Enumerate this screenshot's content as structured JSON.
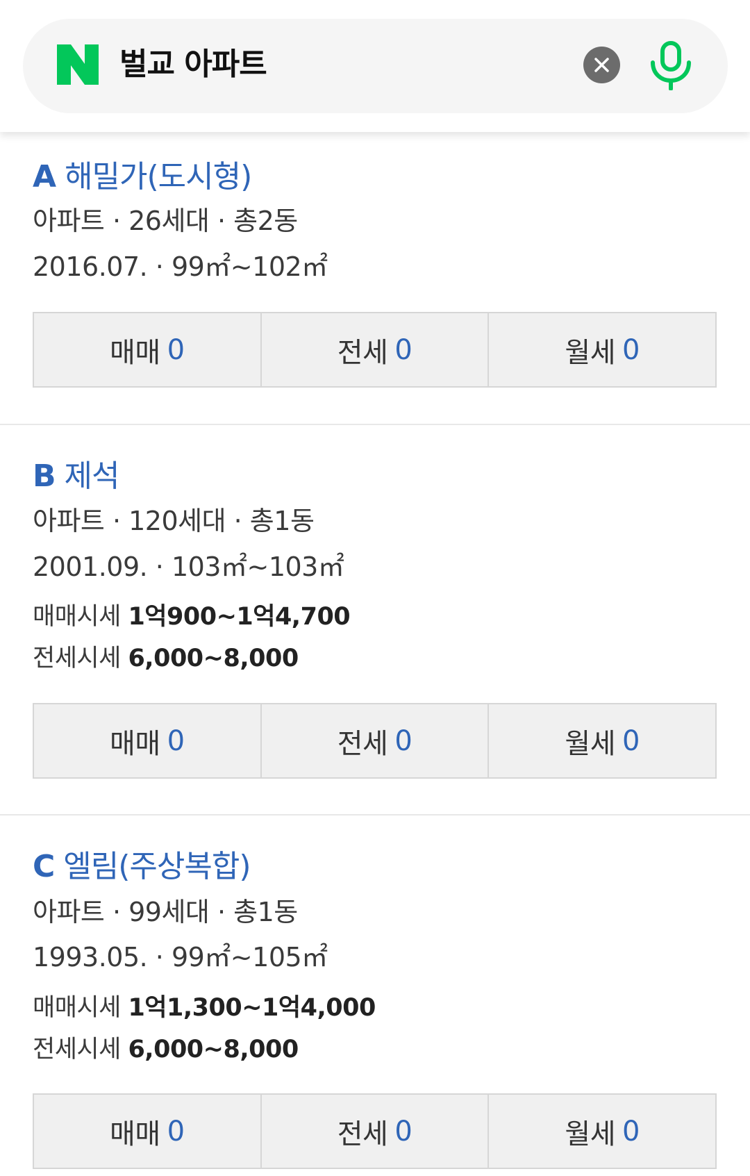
{
  "search": {
    "query": "벌교 아파트",
    "logo": "N",
    "clear_icon": "close-icon",
    "mic_icon": "microphone-icon"
  },
  "colors": {
    "brand_green": "#03c75a",
    "link_blue": "#2f65b7",
    "button_bg": "#f0f0f0"
  },
  "results": [
    {
      "letter": "A",
      "name": "해밀가(도시형)",
      "summary": "아파트 · 26세대 · 총2동",
      "detail": "2016.07. · 99㎡~102㎡",
      "sale_price_label": "",
      "sale_price": "",
      "jeonse_price_label": "",
      "jeonse_price": "",
      "deals": [
        {
          "label": "매매",
          "count": "0"
        },
        {
          "label": "전세",
          "count": "0"
        },
        {
          "label": "월세",
          "count": "0"
        }
      ]
    },
    {
      "letter": "B",
      "name": "제석",
      "summary": "아파트 · 120세대 · 총1동",
      "detail": "2001.09. · 103㎡~103㎡",
      "sale_price_label": "매매시세",
      "sale_price": "1억900~1억4,700",
      "jeonse_price_label": "전세시세",
      "jeonse_price": "6,000~8,000",
      "deals": [
        {
          "label": "매매",
          "count": "0"
        },
        {
          "label": "전세",
          "count": "0"
        },
        {
          "label": "월세",
          "count": "0"
        }
      ]
    },
    {
      "letter": "C",
      "name": "엘림(주상복합)",
      "summary": "아파트 · 99세대 · 총1동",
      "detail": "1993.05. · 99㎡~105㎡",
      "sale_price_label": "매매시세",
      "sale_price": "1억1,300~1억4,000",
      "jeonse_price_label": "전세시세",
      "jeonse_price": "6,000~8,000",
      "deals": [
        {
          "label": "매매",
          "count": "0"
        },
        {
          "label": "전세",
          "count": "0"
        },
        {
          "label": "월세",
          "count": "0"
        }
      ]
    }
  ]
}
